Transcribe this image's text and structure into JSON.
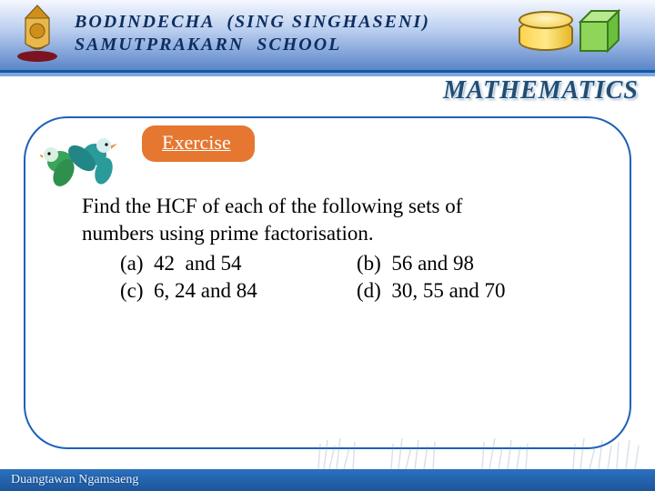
{
  "header": {
    "school_line1": "BODINDECHA  (SING SINGHASENI)",
    "school_line2": "SAMUTPRAKARN  SCHOOL",
    "subject": "MATHEMATICS"
  },
  "exercise": {
    "badge": "Exercise",
    "prompt_line1": "Find the HCF of each of the  following sets of",
    "prompt_line2": "numbers  using prime factorisation.",
    "options": {
      "a": "(a)  42  and 54",
      "b": "(b)  56 and 98",
      "c": "(c)  6, 24 and 84",
      "d": "(d)  30, 55 and 70"
    }
  },
  "footer": {
    "author": "Duangtawan  Ngamsaeng"
  }
}
